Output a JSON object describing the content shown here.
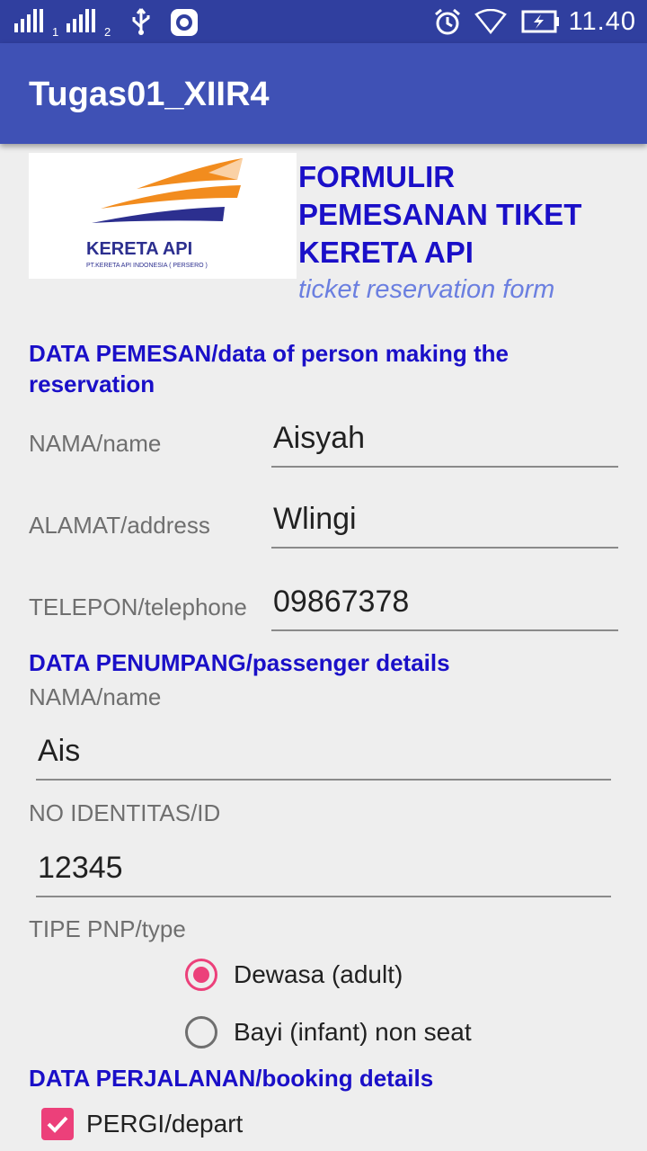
{
  "status_bar": {
    "sim1": "1",
    "sim2": "2",
    "time": "11.40",
    "icons": [
      "signal-icon",
      "usb-icon",
      "screen-record-icon",
      "alarm-icon",
      "wifi-icon",
      "battery-charging-icon"
    ]
  },
  "app_bar": {
    "title": "Tugas01_XIIR4"
  },
  "header": {
    "logo_brand": "KERETA API",
    "logo_sub": "PT.KERETA API INDONESIA ( PERSERO )",
    "title_line1": "FORMULIR",
    "title_line2": "PEMESANAN TIKET",
    "title_line3": "KERETA API",
    "subtitle": "ticket reservation form"
  },
  "pemesan": {
    "heading": "DATA PEMESAN/data of person making the reservation",
    "name_label": "NAMA/name",
    "name_value": "Aisyah",
    "address_label": "ALAMAT/address",
    "address_value": "Wlingi",
    "phone_label": "TELEPON/telephone",
    "phone_value": "09867378"
  },
  "penumpang": {
    "heading": "DATA PENUMPANG/passenger details",
    "name_label": "NAMA/name",
    "name_value": "Ais",
    "id_label": "NO IDENTITAS/ID",
    "id_value": "12345",
    "type_label": "TIPE PNP/type",
    "type_options": [
      "Dewasa (adult)",
      "Bayi (infant) non seat"
    ],
    "type_selected": "Dewasa (adult)"
  },
  "perjalanan": {
    "heading": "DATA PERJALANAN/booking details",
    "depart_label": "PERGI/depart",
    "depart_checked": true
  },
  "colors": {
    "status_bar": "#303f9f",
    "app_bar": "#3f51b5",
    "heading": "#1a0fc8",
    "accent": "#ec407a"
  }
}
